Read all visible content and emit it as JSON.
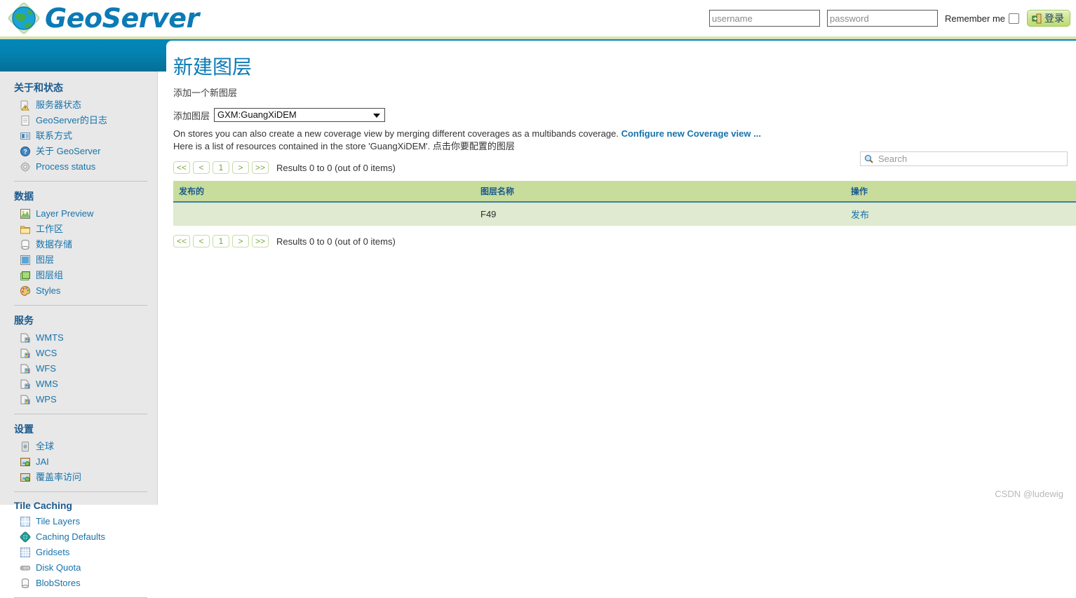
{
  "header": {
    "brand": "GeoServer",
    "logo_icon": "globe-icon",
    "login": {
      "username_placeholder": "username",
      "username_value": "",
      "password_placeholder": "password",
      "password_value": "",
      "remember_label": "Remember me",
      "remember_checked": false,
      "login_button_label": "登录",
      "login_button_icon": "door-enter-icon"
    }
  },
  "sidebar": {
    "sections": [
      {
        "title": "关于和状态",
        "items": [
          {
            "label": "服务器状态",
            "icon": "server-status-icon"
          },
          {
            "label": "GeoServer的日志",
            "icon": "document-icon"
          },
          {
            "label": "联系方式",
            "icon": "contact-card-icon"
          },
          {
            "label": "关于 GeoServer",
            "icon": "help-circle-icon"
          },
          {
            "label": "Process status",
            "icon": "gear-icon"
          }
        ]
      },
      {
        "title": "数据",
        "items": [
          {
            "label": "Layer Preview",
            "icon": "map-preview-icon"
          },
          {
            "label": "工作区",
            "icon": "folder-icon"
          },
          {
            "label": "数据存储",
            "icon": "database-icon"
          },
          {
            "label": "图层",
            "icon": "layer-icon"
          },
          {
            "label": "图层组",
            "icon": "layer-group-icon"
          },
          {
            "label": "Styles",
            "icon": "palette-icon"
          }
        ]
      },
      {
        "title": "服务",
        "items": [
          {
            "label": "WMTS",
            "icon": "service-icon"
          },
          {
            "label": "WCS",
            "icon": "service-icon"
          },
          {
            "label": "WFS",
            "icon": "service-icon"
          },
          {
            "label": "WMS",
            "icon": "service-icon"
          },
          {
            "label": "WPS",
            "icon": "service-icon"
          }
        ]
      },
      {
        "title": "设置",
        "items": [
          {
            "label": "全球",
            "icon": "globe-settings-icon"
          },
          {
            "label": "JAI",
            "icon": "image-settings-icon"
          },
          {
            "label": "覆盖率访问",
            "icon": "image-settings-icon"
          }
        ]
      },
      {
        "title": "Tile Caching",
        "items": [
          {
            "label": "Tile Layers",
            "icon": "tile-layers-icon"
          },
          {
            "label": "Caching Defaults",
            "icon": "cache-globe-icon"
          },
          {
            "label": "Gridsets",
            "icon": "grid-icon"
          },
          {
            "label": "Disk Quota",
            "icon": "disk-icon"
          },
          {
            "label": "BlobStores",
            "icon": "blobstore-icon"
          }
        ]
      }
    ]
  },
  "main": {
    "title": "新建图层",
    "subtitle": "添加一个新图层",
    "select_label": "添加图层",
    "store_selected": "GXM:GuangXiDEM",
    "store_options": [
      "GXM:GuangXiDEM"
    ],
    "description_line1_prefix": "On stores you can also create a new coverage view by merging different coverages as a multibands coverage. ",
    "description_line1_link": "Configure new Coverage view ...",
    "description_line2": "Here is a list of resources contained in the store 'GuangXiDEM'. 点击你要配置的图层",
    "search": {
      "placeholder": "Search",
      "value": "",
      "icon": "search-icon"
    },
    "pager": {
      "first_label": "<<",
      "prev_label": "<",
      "page_label": "1",
      "next_label": ">",
      "last_label": ">>",
      "results_text": "Results 0 to 0 (out of 0 items)"
    },
    "table": {
      "columns": [
        "发布的",
        "图层名称",
        "操作"
      ],
      "rows": [
        {
          "published": "",
          "layer_name": "F49",
          "action": "发布"
        }
      ]
    }
  },
  "watermark": "CSDN @ludewig",
  "colors": {
    "brand_blue": "#0c7ab5",
    "band_blue": "#0287b9",
    "band_green": "#d5e3b4",
    "table_header_green": "#c8dd9c",
    "table_row_green": "#dfead0",
    "link_blue": "#1673ab",
    "sidebar_bg": "#e8e8e8"
  }
}
